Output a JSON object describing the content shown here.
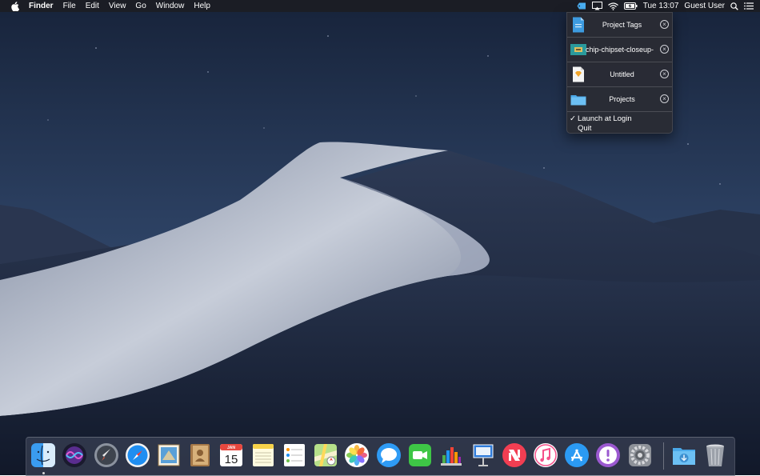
{
  "menubar": {
    "app_name": "Finder",
    "menus": [
      "File",
      "Edit",
      "View",
      "Go",
      "Window",
      "Help"
    ],
    "clock": "Tue 13:07",
    "user": "Guest User",
    "status_icons": [
      "tags-app-icon",
      "airplay-icon",
      "wifi-icon",
      "battery-icon",
      "search-icon",
      "notification-center-icon"
    ]
  },
  "dropdown": {
    "items": [
      {
        "label": "Project Tags",
        "icon": "document-icon"
      },
      {
        "label": "chip-chipset-closeup-",
        "icon": "image-thumbnail-icon"
      },
      {
        "label": "Untitled",
        "icon": "sketch-file-icon"
      },
      {
        "label": "Projects",
        "icon": "folder-icon"
      }
    ],
    "options": {
      "launch_at_login": "Launch at Login",
      "launch_checked_mark": "✓",
      "quit": "Quit"
    }
  },
  "dock": {
    "calendar_month": "JAN",
    "calendar_day": "15",
    "apps": [
      "finder-icon",
      "siri-icon",
      "launchpad-icon",
      "safari-icon",
      "mail-icon",
      "contacts-icon",
      "calendar-icon",
      "notes-icon",
      "reminders-icon",
      "maps-icon",
      "photos-icon",
      "messages-icon",
      "facetime-icon",
      "numbers-icon",
      "keynote-icon",
      "news-icon",
      "itunes-icon",
      "app-store-icon",
      "feedback-icon",
      "system-preferences-icon",
      "downloads-folder-icon",
      "trash-icon"
    ]
  },
  "colors": {
    "sky_top": "#1b2a44",
    "sky_bottom": "#3a5278",
    "dune_light": "#c9cfdc",
    "dune_dark": "#1a2438"
  }
}
